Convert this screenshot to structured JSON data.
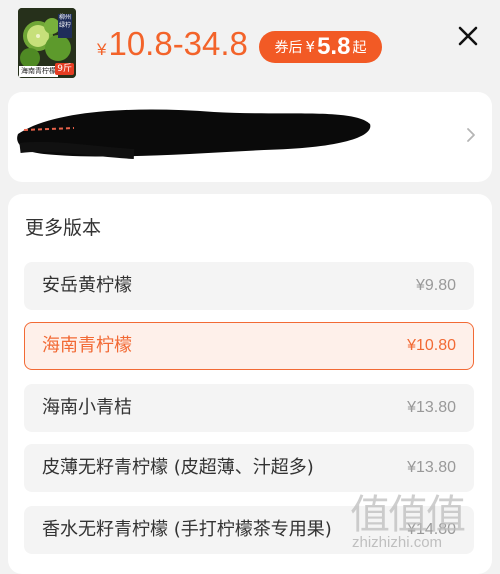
{
  "product": {
    "thumb_name": "海南青柠檬",
    "thumb_weight": "9斤",
    "thumb_flag": "柳州 绿柠",
    "price_currency": "¥",
    "price_range": "10.8-34.8"
  },
  "coupon": {
    "label": "券后",
    "currency": "¥",
    "value": "5.8",
    "suffix": "起"
  },
  "versions": {
    "title": "更多版本",
    "options": [
      {
        "name": "安岳黄柠檬",
        "price": "¥9.80",
        "selected": false
      },
      {
        "name": "海南青柠檬",
        "price": "¥10.80",
        "selected": true
      },
      {
        "name": "海南小青桔",
        "price": "¥13.80",
        "selected": false
      },
      {
        "name": "皮薄无籽青柠檬 (皮超薄、汁超多)",
        "price": "¥13.80",
        "selected": false
      },
      {
        "name": "香水无籽青柠檬 (手打柠檬茶专用果)",
        "price": "¥14.80",
        "selected": false
      }
    ]
  },
  "watermark": {
    "glyphs": "值值值",
    "url": "zhizhizhi.com"
  },
  "colors": {
    "accent": "#f25a25",
    "selected_bg": "#fef0ea",
    "page_bg": "#f2f2f2"
  },
  "icons": {
    "close": "close-icon",
    "chevron": "chevron-right-icon"
  }
}
